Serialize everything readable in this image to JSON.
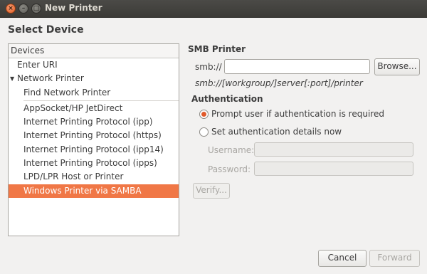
{
  "window": {
    "title": "New Printer",
    "close_glyph": "×",
    "minimize_glyph": "–",
    "maximize_glyph": "□"
  },
  "heading": "Select Device",
  "devices": {
    "column_header": "Devices",
    "enter_uri": "Enter URI",
    "network_printer": "Network Printer",
    "expander_glyph": "▼",
    "find_network_printer": "Find Network Printer",
    "items": [
      "AppSocket/HP JetDirect",
      "Internet Printing Protocol (ipp)",
      "Internet Printing Protocol (https)",
      "Internet Printing Protocol (ipp14)",
      "Internet Printing Protocol (ipps)",
      "LPD/LPR Host or Printer",
      "Windows Printer via SAMBA"
    ],
    "selected_index": 6
  },
  "smb": {
    "section_title": "SMB Printer",
    "prefix_label": "smb://",
    "uri_value": "",
    "browse_label": "Browse...",
    "hint": "smb://[workgroup/]server[:port]/printer"
  },
  "auth": {
    "section_title": "Authentication",
    "option_prompt": "Prompt user if authentication is required",
    "option_set": "Set authentication details now",
    "selected": "prompt",
    "username_label": "Username:",
    "password_label": "Password:",
    "verify_label": "Verify..."
  },
  "footer": {
    "cancel_label": "Cancel",
    "forward_label": "Forward"
  },
  "colors": {
    "accent": "#f07746",
    "radio_dot": "#e0592a"
  }
}
